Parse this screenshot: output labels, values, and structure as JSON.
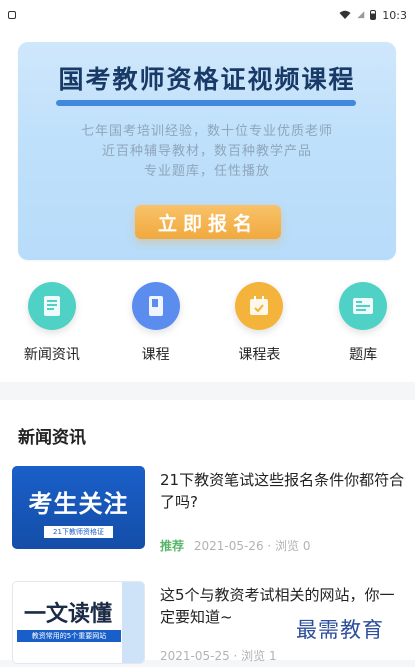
{
  "status": {
    "time": "10:3"
  },
  "banner": {
    "title": "国考教师资格证视频课程",
    "desc_lines": [
      "七年国考培训经验，数十位专业优质老师",
      "近百种辅导教材，数百种教学产品",
      "专业题库，任性播放"
    ],
    "button_label": "立即报名"
  },
  "nav": [
    {
      "label": "新闻资讯",
      "icon": "news-icon",
      "color": "#4fd1c5"
    },
    {
      "label": "课程",
      "icon": "course-icon",
      "color": "#5b8def"
    },
    {
      "label": "课程表",
      "icon": "calendar-icon",
      "color": "#f4b33a"
    },
    {
      "label": "题库",
      "icon": "question-bank-icon",
      "color": "#4fd1c5"
    }
  ],
  "section": {
    "title": "新闻资讯"
  },
  "news": [
    {
      "title": "21下教资笔试这些报名条件你都符合了吗?",
      "tag": "推荐",
      "meta": "2021-05-26 · 浏览 0",
      "thumb_main": "考生关注",
      "thumb_sub": "21下教师资格证"
    },
    {
      "title": "这5个与教资考试相关的网站，你一定要知道~",
      "meta": "2021-05-25 · 浏览 1",
      "thumb_main": "一文读懂",
      "thumb_sub": "教资常用的5个重要网站"
    }
  ],
  "watermark": "最需教育"
}
